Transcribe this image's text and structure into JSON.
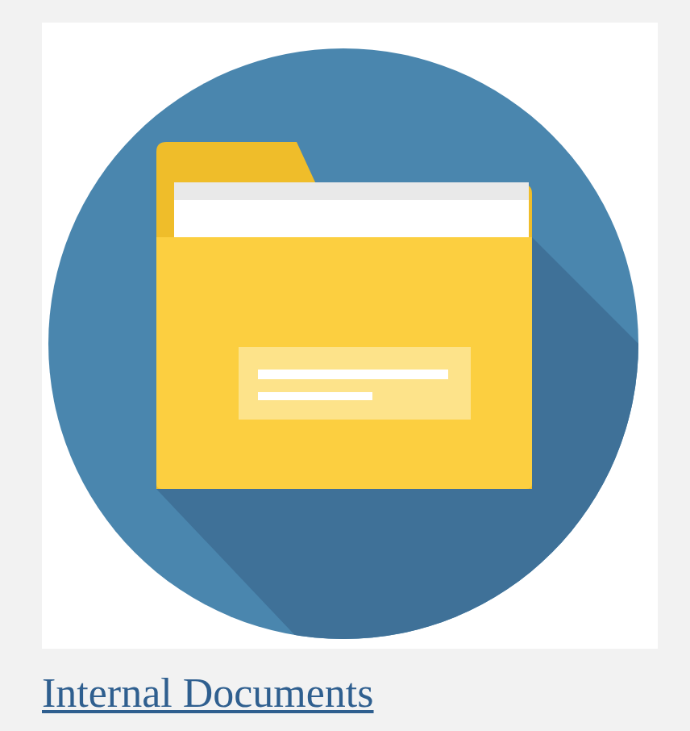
{
  "tile": {
    "link": "Internal Documents"
  }
}
